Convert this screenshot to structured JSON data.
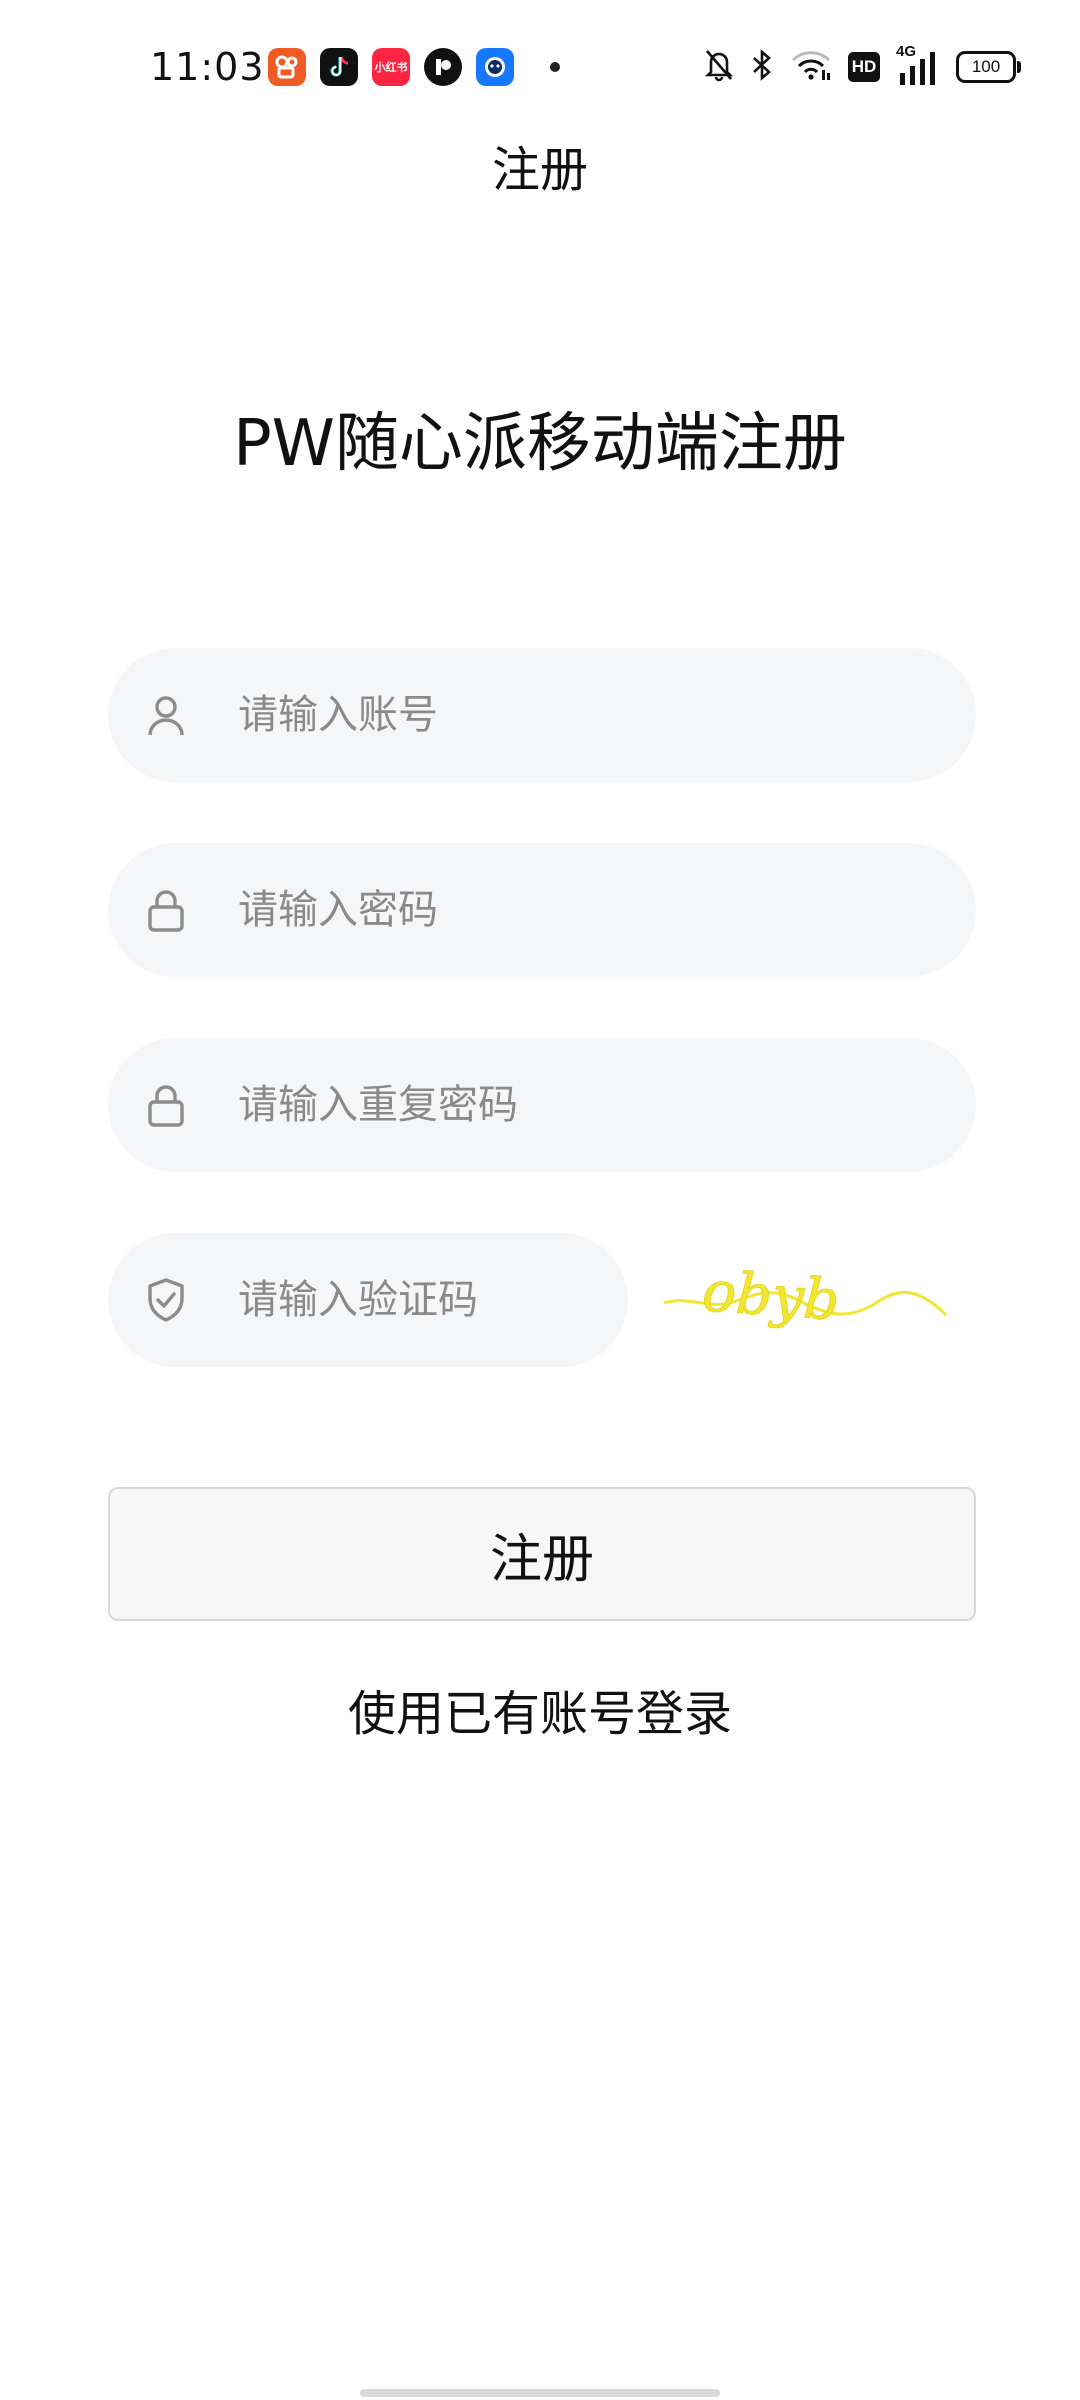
{
  "status_bar": {
    "time": "11:03",
    "battery": "100",
    "hd_label": "HD",
    "network_label": "4G",
    "app_icons": [
      "kuaishou-icon",
      "douyin-icon",
      "xiaohongshu-icon",
      "app-p-icon",
      "blue-robot-app-icon"
    ],
    "xiaohongshu_label": "小红书"
  },
  "nav": {
    "title": "注册"
  },
  "heading": "PW随心派移动端注册",
  "form": {
    "account_placeholder": "请输入账号",
    "password_placeholder": "请输入密码",
    "repeat_password_placeholder": "请输入重复密码",
    "captcha_placeholder": "请输入验证码",
    "captcha_text": "obyb",
    "register_label": "注册",
    "login_link": "使用已有账号登录"
  },
  "colors": {
    "field_background": "#f5f6f8",
    "placeholder": "#8a8a8a",
    "captcha": "#f2e632",
    "button_background": "#f7f7f7",
    "button_border": "#d8d8d8"
  }
}
